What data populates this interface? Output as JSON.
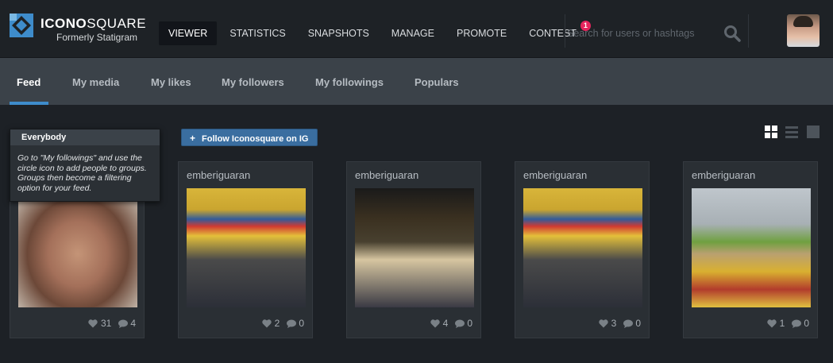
{
  "brand": {
    "name_bold": "ICONO",
    "name_rest": "SQUARE",
    "subtitle": "Formerly Statigram"
  },
  "nav": {
    "items": [
      {
        "label": "VIEWER",
        "active": true
      },
      {
        "label": "STATISTICS"
      },
      {
        "label": "SNAPSHOTS"
      },
      {
        "label": "MANAGE"
      },
      {
        "label": "PROMOTE"
      },
      {
        "label": "CONTEST",
        "badge": "1"
      }
    ]
  },
  "search": {
    "placeholder": "Search for users or hashtags",
    "icon": "search-icon"
  },
  "subnav": {
    "tabs": [
      {
        "label": "Feed",
        "active": true
      },
      {
        "label": "My media"
      },
      {
        "label": "My likes"
      },
      {
        "label": "My followers"
      },
      {
        "label": "My followings"
      },
      {
        "label": "Populars"
      }
    ]
  },
  "follow_button": {
    "label": "Follow Iconosquare on IG",
    "icon": "plus-icon"
  },
  "view_modes": [
    "grid-view-icon",
    "list-view-icon",
    "large-view-icon"
  ],
  "tooltip": {
    "title": "Everybody",
    "text": "Go to \"My followings\" and use the circle icon to add people to groups. Groups then become a filtering option for your feed."
  },
  "cards": [
    {
      "user": "",
      "likes": "31",
      "comments": "4"
    },
    {
      "user": "emberiguaran",
      "likes": "2",
      "comments": "0"
    },
    {
      "user": "emberiguaran",
      "likes": "4",
      "comments": "0"
    },
    {
      "user": "emberiguaran",
      "likes": "3",
      "comments": "0"
    },
    {
      "user": "emberiguaran",
      "likes": "1",
      "comments": "0"
    }
  ],
  "colors": {
    "accent": "#3e8ccb",
    "badge": "#e5255d",
    "topbar": "#1e2226",
    "subnav": "#3b4249",
    "follow_button": "#3a6ea0"
  }
}
